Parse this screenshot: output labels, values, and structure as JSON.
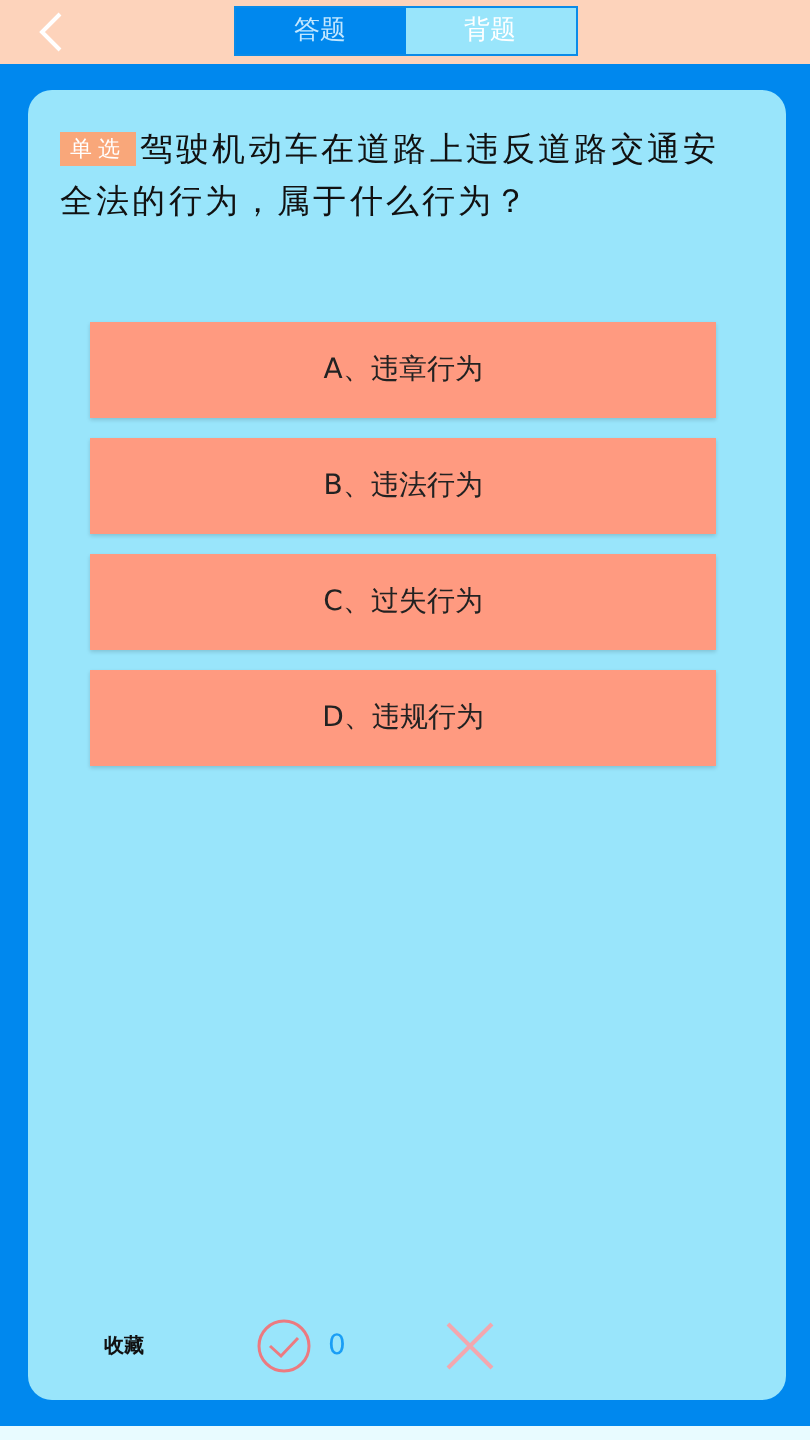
{
  "tabs": [
    {
      "label": "答题",
      "selected": true
    },
    {
      "label": "背题",
      "selected": false
    }
  ],
  "question": {
    "type_badge": "单选",
    "text": "驾驶机动车在道路上违反道路交通安全法的行为，属于什么行为？"
  },
  "options": [
    {
      "label": "A、违章行为"
    },
    {
      "label": "B、违法行为"
    },
    {
      "label": "C、过失行为"
    },
    {
      "label": "D、违规行为"
    }
  ],
  "footer": {
    "favorite": "收藏",
    "correct_count": "0"
  }
}
